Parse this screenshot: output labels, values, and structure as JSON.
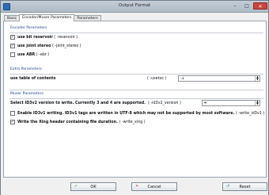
{
  "window": {
    "title": "Output Format"
  },
  "tabs": [
    {
      "label": "Basic"
    },
    {
      "label": "Encoder/Muxer Parameters"
    },
    {
      "label": "Parameters"
    }
  ],
  "encoder": {
    "title": "Encoder Parameters",
    "items": [
      {
        "label": "use bit reservoir",
        "param": "( -reservoir )",
        "checked": true
      },
      {
        "label": "use joint stereo",
        "param": "( -joint_stereo )",
        "checked": true
      },
      {
        "label": "use ABR",
        "param": "( -abr )",
        "checked": false
      }
    ]
  },
  "extra": {
    "title": "Extra Parameters",
    "toc_label": "use table of contents",
    "toc_param": "( -usetoc )",
    "toc_value": "-1"
  },
  "muxer": {
    "title": "Muxer Parameters",
    "id3_label": "Select ID3v2 version to write. Currently 3 and 4 are supported.",
    "id3_param": "( -id3v2_version )",
    "id3_value": "4",
    "items": [
      {
        "label": "Enable ID3v1 writing. ID3v1 tags are written in UTF-8 which may not be supported by most software.",
        "param": "( -write_id3v1 )",
        "checked": false
      },
      {
        "label": "Write the Xing header containing file duration.",
        "param": "( -write_xing )",
        "checked": true
      }
    ]
  },
  "buttons": {
    "ok": "OK",
    "cancel": "Cancel",
    "reset": "Reset"
  },
  "colors": {
    "accent": "#1f3f8f",
    "close": "#c9463d",
    "ok_icon": "#1f8f2a",
    "cancel_icon": "#c9463d"
  },
  "icons": [
    "app-icon",
    "minimize-icon",
    "maximize-icon",
    "close-icon",
    "checkmark-icon",
    "x-icon",
    "reset-icon",
    "spin-up-icon",
    "spin-down-icon"
  ]
}
